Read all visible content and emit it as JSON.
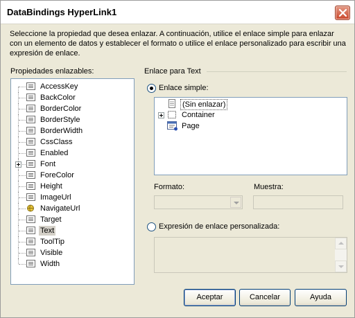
{
  "window": {
    "title": "DataBindings HyperLink1"
  },
  "description": "Seleccione la propiedad que desea enlazar. A continuación, utilice el enlace simple para enlazar con un elemento de datos y establecer el formato o utilice el enlace personalizado para escribir una expresión de enlace.",
  "properties": {
    "label": "Propiedades enlazables:",
    "selected": "Text",
    "items": [
      "AccessKey",
      "BackColor",
      "BorderColor",
      "BorderStyle",
      "BorderWidth",
      "CssClass",
      "Enabled",
      "Font",
      "ForeColor",
      "Height",
      "ImageUrl",
      "NavigateUrl",
      "Target",
      "Text",
      "ToolTip",
      "Visible",
      "Width"
    ],
    "expandable": [
      "Font"
    ],
    "icons": {
      "default": "property-icon",
      "NavigateUrl": "url-property-icon"
    }
  },
  "binding": {
    "group_label": "Enlace para Text",
    "simple_label": "Enlace simple:",
    "simple_checked": true,
    "tree": [
      {
        "label": "(Sin enlazar)",
        "icon": "unbound-icon",
        "selected": true
      },
      {
        "label": "Container",
        "icon": "container-icon",
        "expandable": true
      },
      {
        "label": "Page",
        "icon": "page-icon"
      }
    ],
    "format_label": "Formato:",
    "format_value": "",
    "sample_label": "Muestra:",
    "sample_value": "",
    "custom_label": "Expresión de enlace personalizada:",
    "custom_checked": false,
    "custom_value": ""
  },
  "buttons": {
    "ok": "Aceptar",
    "cancel": "Cancelar",
    "help": "Ayuda"
  }
}
